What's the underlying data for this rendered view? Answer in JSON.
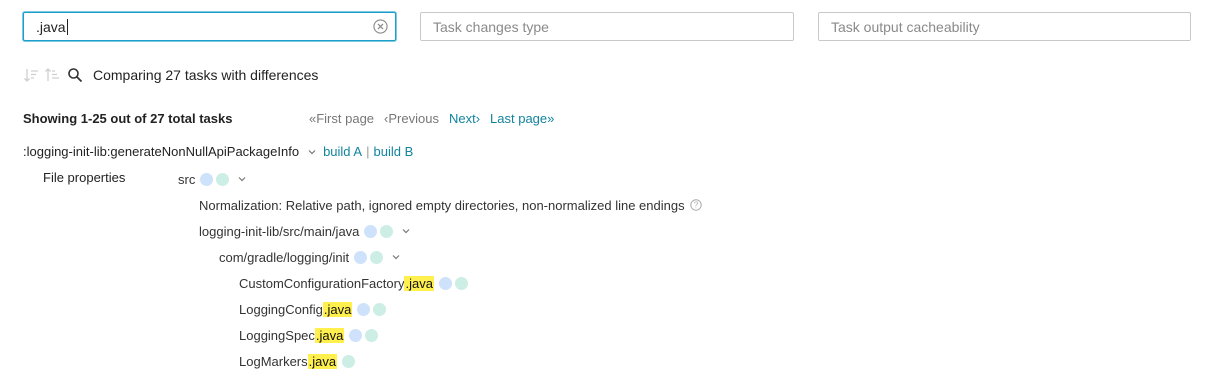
{
  "filters": {
    "task_path": {
      "value": ".java",
      "placeholder": ""
    },
    "changes_type": {
      "placeholder": "Task changes type"
    },
    "cacheability": {
      "placeholder": "Task output cacheability"
    }
  },
  "toolbar": {
    "summary": "Comparing 27 tasks with differences"
  },
  "pagination": {
    "showing": "Showing 1-25 out of 27 total tasks",
    "first": "«First page",
    "previous": "‹Previous",
    "next": "Next›",
    "last": "Last page»"
  },
  "task": {
    "path": ":logging-init-lib:generateNonNullApiPackageInfo",
    "build_a": "build A",
    "sep": "|",
    "build_b": "build B"
  },
  "file_properties": {
    "label": "File properties",
    "root": "src",
    "normalization": "Normalization: Relative path, ignored empty directories, non-normalized line endings",
    "dir1": "logging-init-lib/src/main/java",
    "dir2": "com/gradle/logging/init",
    "files": [
      {
        "base": "CustomConfigurationFactory",
        "match": ".java",
        "dots": [
          "blue",
          "green"
        ]
      },
      {
        "base": "LoggingConfig",
        "match": ".java",
        "dots": [
          "blue",
          "green"
        ]
      },
      {
        "base": "LoggingSpec",
        "match": ".java",
        "dots": [
          "blue",
          "green"
        ]
      },
      {
        "base": "LogMarkers",
        "match": ".java",
        "dots": [
          "green"
        ]
      }
    ]
  },
  "colors": {
    "accent": "#12849e",
    "highlight": "#fff04d",
    "dot_blue": "#cfe2fb",
    "dot_green": "#cdeee4"
  }
}
